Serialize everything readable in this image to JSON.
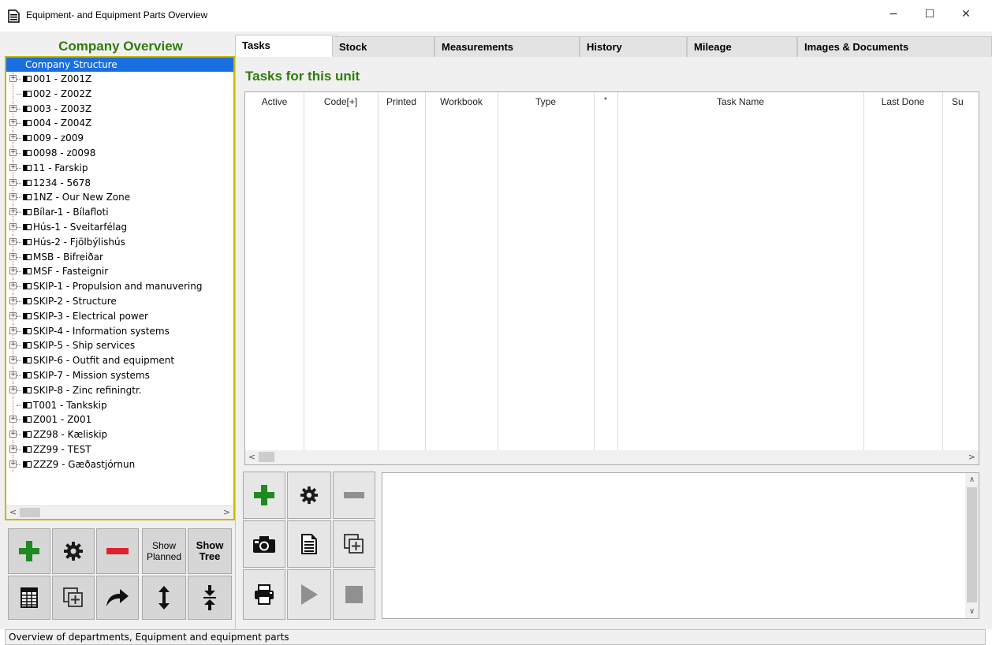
{
  "window": {
    "title": "Equipment- and Equipment Parts Overview",
    "minimize": "−",
    "maximize": "☐",
    "close": "✕"
  },
  "left_panel": {
    "title": "Company Overview",
    "tree": {
      "root": "Company Structure",
      "items": [
        {
          "label": "001 - Z001Z",
          "expandable": true
        },
        {
          "label": "002 - Z002Z",
          "expandable": false
        },
        {
          "label": "003 - Z003Z",
          "expandable": true
        },
        {
          "label": "004 - Z004Z",
          "expandable": true
        },
        {
          "label": "009 - z009",
          "expandable": true
        },
        {
          "label": "0098 - z0098",
          "expandable": true
        },
        {
          "label": "11 - Farskip",
          "expandable": true
        },
        {
          "label": "1234 - 5678",
          "expandable": true
        },
        {
          "label": "1NZ - Our New Zone",
          "expandable": true
        },
        {
          "label": "Bílar-1 - Bílafloti",
          "expandable": true
        },
        {
          "label": "Hús-1 - Sveitarfélag",
          "expandable": true
        },
        {
          "label": "Hús-2 - Fjölbýlishús",
          "expandable": true
        },
        {
          "label": "MSB - Bifreiðar",
          "expandable": true
        },
        {
          "label": "MSF - Fasteignir",
          "expandable": true
        },
        {
          "label": "SKIP-1 - Propulsion and manuvering",
          "expandable": true
        },
        {
          "label": "SKIP-2 - Structure",
          "expandable": true
        },
        {
          "label": "SKIP-3 - Electrical power",
          "expandable": true
        },
        {
          "label": "SKIP-4 - Information systems",
          "expandable": true
        },
        {
          "label": "SKIP-5 - Ship services",
          "expandable": true
        },
        {
          "label": "SKIP-6 - Outfit and equipment",
          "expandable": true
        },
        {
          "label": "SKIP-7 - Mission systems",
          "expandable": true
        },
        {
          "label": "SKIP-8 - Zinc refiningtr.",
          "expandable": true
        },
        {
          "label": "T001 - Tankskip",
          "expandable": false
        },
        {
          "label": "Z001 - Z001",
          "expandable": true
        },
        {
          "label": "ZZ98 - Kæliskip",
          "expandable": true
        },
        {
          "label": "ZZ99 - TEST",
          "expandable": true
        },
        {
          "label": "ZZZ9 - Gæðastjórnun",
          "expandable": true
        }
      ]
    },
    "buttons": {
      "show_planned": "Show Planned",
      "show_planned_line1": "Show",
      "show_planned_line2": "Planned",
      "show_tree_line1": "Show",
      "show_tree_line2": "Tree"
    }
  },
  "tabs": [
    {
      "label": "Tasks",
      "active": true
    },
    {
      "label": "Stock",
      "active": false
    },
    {
      "label": "Measurements",
      "active": false
    },
    {
      "label": "History",
      "active": false
    },
    {
      "label": "Mileage",
      "active": false
    },
    {
      "label": "Images & Documents",
      "active": false
    }
  ],
  "tasks": {
    "heading": "Tasks for this unit",
    "columns": [
      "Active",
      "Code[+]",
      "Printed",
      "Workbook",
      "Type",
      "*",
      "Task Name",
      "Last Done",
      "Su"
    ]
  },
  "status": {
    "text": "Overview of departments, Equipment and equipment parts"
  },
  "colors": {
    "accent_green": "#2e7d0a",
    "selection_blue": "#1a6fe0",
    "tree_border": "#c7b800",
    "remove_red": "#e0202a"
  }
}
